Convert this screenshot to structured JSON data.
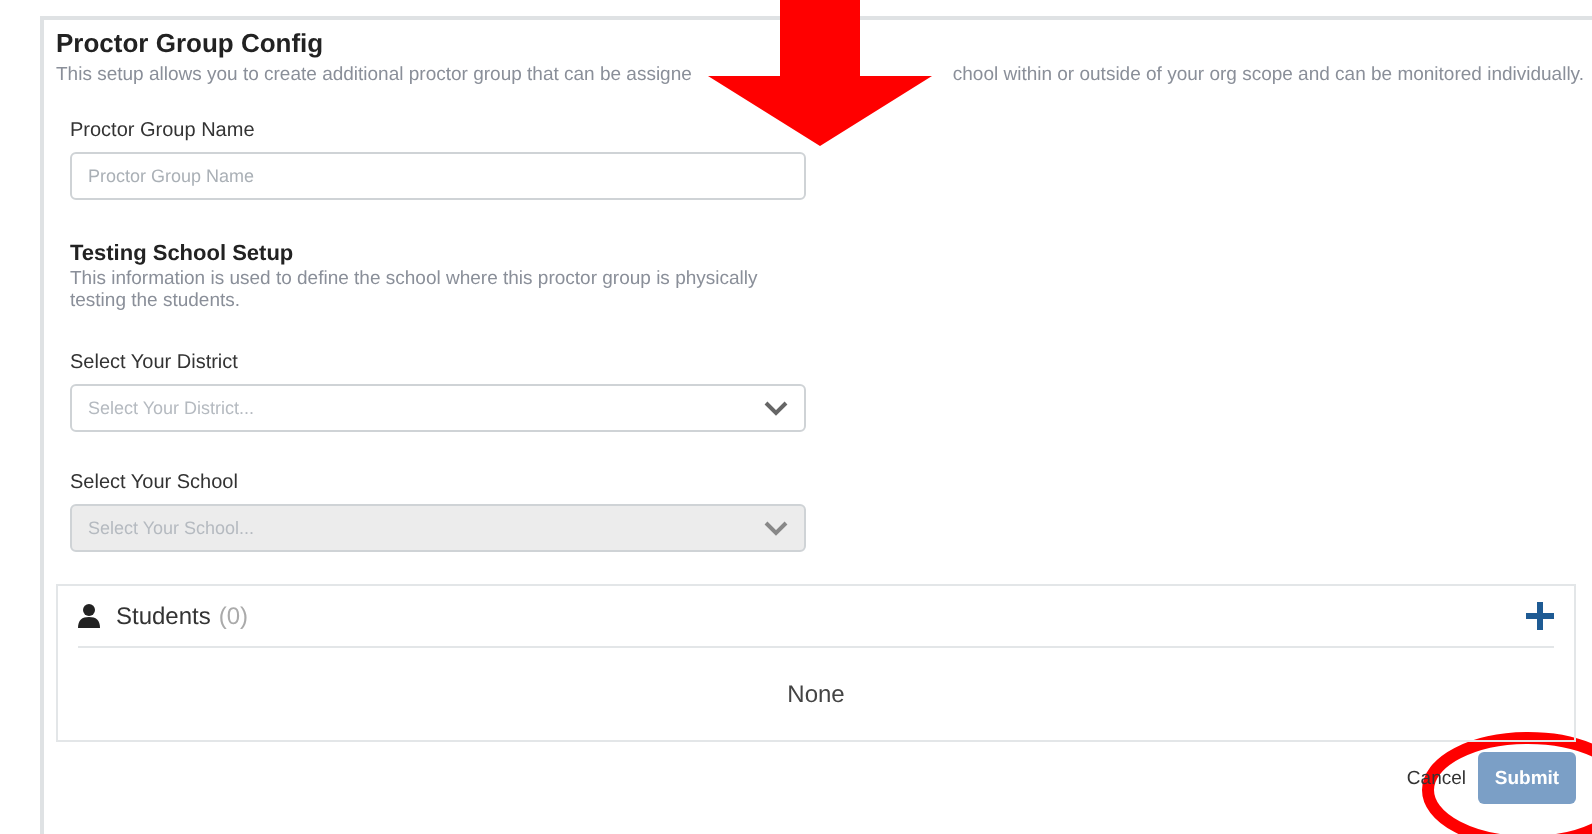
{
  "header": {
    "title": "Proctor Group Config",
    "description_parts": [
      "This setup allows you to create additional proctor group that can be assigne",
      "chool within or outside of your org scope and can be monitored individually."
    ]
  },
  "fields": [
    {
      "kind": "text",
      "label": "Proctor Group Name",
      "placeholder": "Proctor Group Name",
      "disabled": false
    },
    {
      "kind": "section",
      "title": "Testing School Setup",
      "description": "This information is used to define the school where this proctor group is physically testing the students."
    },
    {
      "kind": "select",
      "label": "Select Your District",
      "placeholder": "Select Your District...",
      "disabled": false
    },
    {
      "kind": "select",
      "label": "Select Your School",
      "placeholder": "Select Your School...",
      "disabled": true
    }
  ],
  "students": {
    "title": "Students",
    "count": "(0)",
    "empty_text": "None"
  },
  "buttons": [
    {
      "kind": "cancel",
      "label": "Cancel"
    },
    {
      "kind": "submit",
      "label": "Submit"
    }
  ]
}
